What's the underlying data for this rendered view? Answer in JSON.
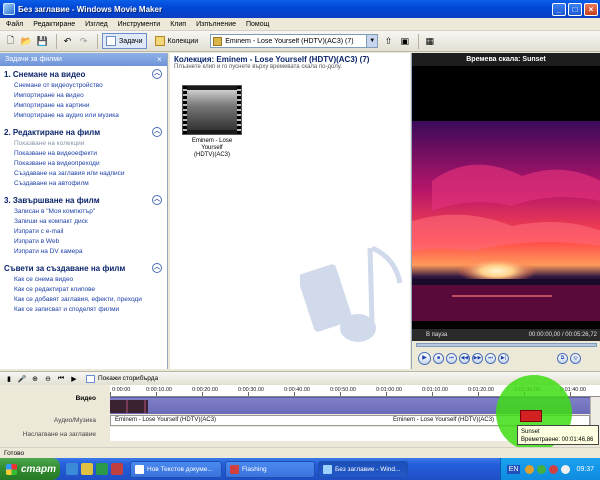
{
  "window": {
    "title": "Без заглавие - Windows Movie Maker"
  },
  "menu": [
    "Файл",
    "Редактиране",
    "Изглед",
    "Инструменти",
    "Клип",
    "Изпълнение",
    "Помощ"
  ],
  "toolbar": {
    "tasks_label": "Задачи",
    "collections_label": "Колекции",
    "collection_select": "Eminem - Lose Yourself (HDTV)(AC3) (7)"
  },
  "tasks_pane": {
    "header": "Задачи за филми",
    "sections": [
      {
        "title": "1. Снемане на видео",
        "links": [
          {
            "label": "Снемане от видеоустройство",
            "enabled": true
          },
          {
            "label": "Импортиране на видео",
            "enabled": true
          },
          {
            "label": "Импортиране на картини",
            "enabled": true
          },
          {
            "label": "Импортиране на аудио или музика",
            "enabled": true
          }
        ]
      },
      {
        "title": "2. Редактиране на филм",
        "links": [
          {
            "label": "Показване на колекции",
            "enabled": false
          },
          {
            "label": "Показване на видеоефекти",
            "enabled": true
          },
          {
            "label": "Показване на видеопреходи",
            "enabled": true
          },
          {
            "label": "Създаване на заглавия или надписи",
            "enabled": true
          },
          {
            "label": "Създаване на автофилм",
            "enabled": true
          }
        ]
      },
      {
        "title": "3. Завършване на филм",
        "links": [
          {
            "label": "Записан в \"Моя компютър\"",
            "enabled": true
          },
          {
            "label": "Запиши на компакт диск",
            "enabled": true
          },
          {
            "label": "Изпрати с e-mail",
            "enabled": true
          },
          {
            "label": "Изпрати в Web",
            "enabled": true
          },
          {
            "label": "Изпрати на DV камера",
            "enabled": true
          }
        ]
      },
      {
        "title": "Съвети за създаване на филм",
        "links": [
          {
            "label": "Как се снема видео",
            "enabled": true
          },
          {
            "label": "Как се редактират клипове",
            "enabled": true
          },
          {
            "label": "Как се добавят заглавия, ефекти, преходи",
            "enabled": true
          },
          {
            "label": "Как се записват и споделят филми",
            "enabled": true
          }
        ]
      }
    ]
  },
  "collection": {
    "title": "Колекция: Eminem - Lose Yourself (HDTV)(AC3) (7)",
    "hint": "Плъзнете клип и го пуснете върху времевата скала по-долу.",
    "clip_label_line1": "Eminem - Lose Yourself",
    "clip_label_line2": "(HDTV)(AC3)"
  },
  "preview": {
    "title": "Времева скала: Sunset",
    "state": "В пауза",
    "time": "00:00:00,00 / 00:05:26,72",
    "progress": 0.0
  },
  "timeline": {
    "storyboard_label": "Покажи сторибърда",
    "track_video": "Видео",
    "track_audio": "Аудио/Музика",
    "track_overlay": "Наслагване на заглавие",
    "ruler": [
      "0:00:00",
      "0:00:10.00",
      "0:00:20.00",
      "0:00:30.00",
      "0:00:40.00",
      "0:00:50.00",
      "0:01:00.00",
      "0:01:10.00",
      "0:01:20.00",
      "0:01:30.00",
      "0:01:40.00"
    ],
    "audio_clip_label": "Eminem - Lose Yourself (HDTV)(AC3)",
    "tooltip_line1": "Sunset",
    "tooltip_line2": "Времетраене: 00:01:46,86"
  },
  "statusbar": {
    "text": "Готово"
  },
  "taskbar": {
    "start_label": "старт",
    "buttons": [
      {
        "label": "Нов Текстов докуме...",
        "active": false
      },
      {
        "label": "Flashing",
        "active": false
      },
      {
        "label": "Без заглавие - Wind...",
        "active": true
      }
    ],
    "language": "EN",
    "clock": "09:37"
  },
  "colors": {
    "title_bar": "#0046d5",
    "highlight_bubble": "#40dc14",
    "video_track": "#7474c0"
  }
}
